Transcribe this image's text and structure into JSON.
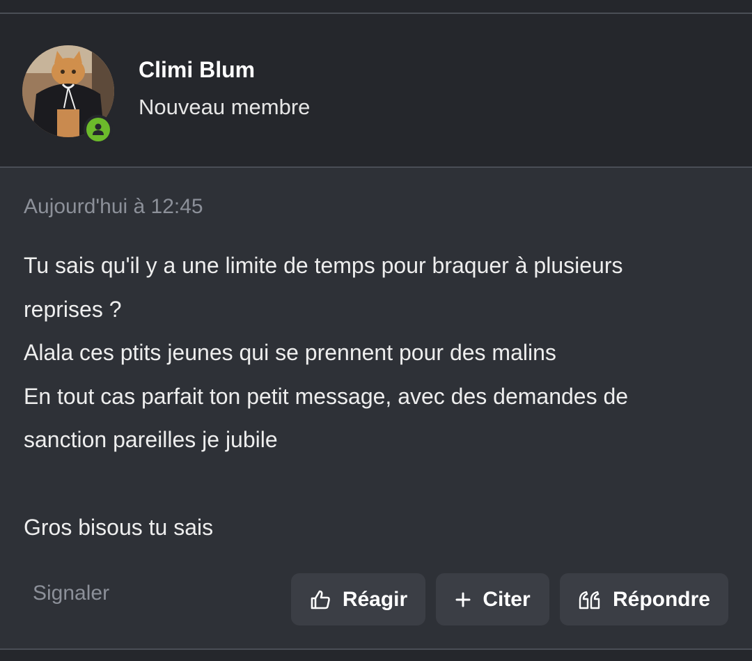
{
  "post": {
    "author": {
      "name": "Climi Blum",
      "role": "Nouveau membre",
      "avatar_icon": "cat-photo-avatar",
      "status_icon": "online-user-icon",
      "status_color": "#6cba2b"
    },
    "timestamp": "Aujourd'hui à 12:45",
    "message_lines": [
      "Tu sais qu'il y a une limite de temps pour braquer à plusieurs",
      "reprises ?",
      "Alala ces ptits jeunes qui se prennent pour des malins",
      "En tout cas parfait ton petit message, avec des demandes de",
      "sanction pareilles je jubile",
      "",
      "Gros bisous tu sais"
    ]
  },
  "actions": {
    "report_label": "Signaler",
    "react_label": "Réagir",
    "quote_label": "Citer",
    "reply_label": "Répondre"
  },
  "colors": {
    "background": "#2e3137",
    "header_background": "#25272c",
    "button_background": "#3b3e45",
    "muted_text": "#8c9099",
    "online_green": "#6cba2b"
  }
}
